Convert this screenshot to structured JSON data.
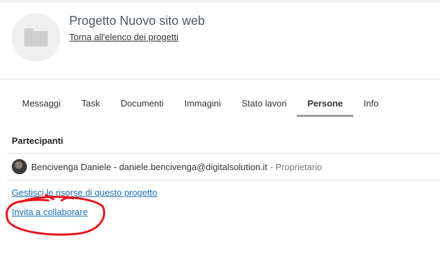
{
  "header": {
    "project_title": "Progetto Nuovo sito web",
    "back_link": "Torna all'elenco dei progetti"
  },
  "tabs": [
    {
      "label": "Messaggi",
      "active": false
    },
    {
      "label": "Task",
      "active": false
    },
    {
      "label": "Documenti",
      "active": false
    },
    {
      "label": "Immagini",
      "active": false
    },
    {
      "label": "Stato lavori",
      "active": false
    },
    {
      "label": "Persone",
      "active": true
    },
    {
      "label": "Info",
      "active": false
    }
  ],
  "participants": {
    "title": "Partecipanti",
    "items": [
      {
        "name": "Bencivenga Daniele - daniele.bencivenga@digitalsolution.it",
        "role": "- Proprietario"
      }
    ]
  },
  "actions": {
    "manage_resources": "Gestisci le risorse di questo progetto",
    "invite": "Invita a collaborare"
  },
  "colors": {
    "link": "#1a6fb5",
    "annotation": "#e8141c",
    "title": "#4a5a6a"
  },
  "icons": {
    "project": "folder-icon"
  }
}
